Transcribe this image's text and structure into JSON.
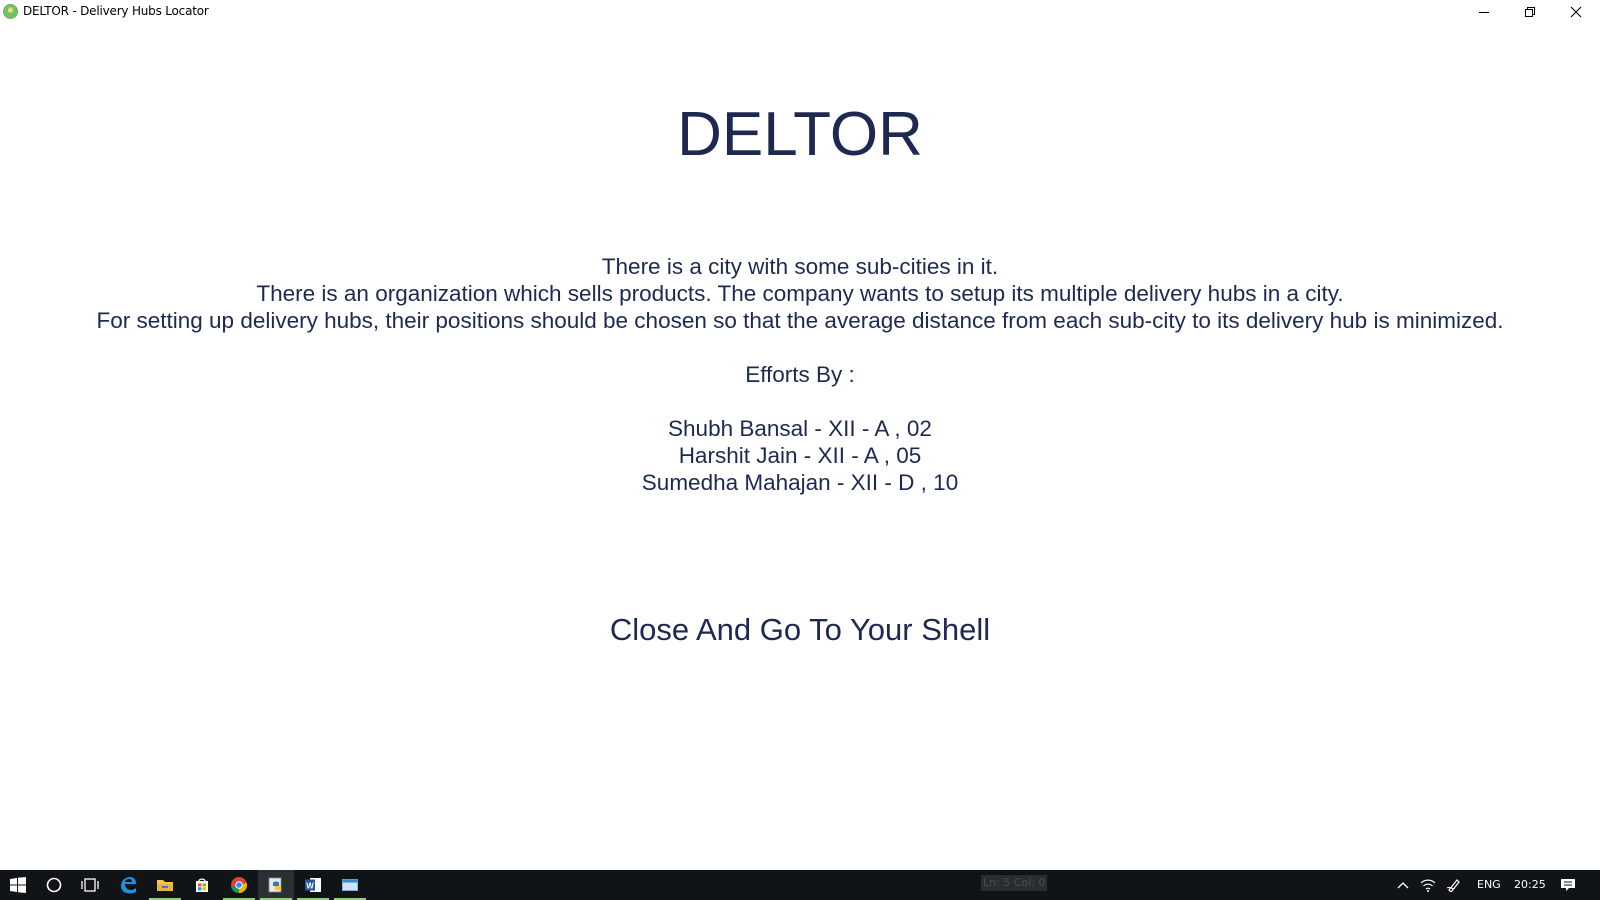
{
  "window": {
    "title": "DELTOR - Delivery Hubs Locator",
    "icon": "app-globe-icon",
    "controls": [
      "minimize-icon",
      "restore-icon",
      "close-icon"
    ]
  },
  "main": {
    "heading": "DELTOR",
    "description_lines": [
      "There is a city with some sub-cities in it.",
      "There is an organization which sells products. The company wants to setup its multiple delivery hubs in a city.",
      "For setting up delivery hubs, their positions should be chosen so that the average distance from each sub-city to its delivery hub is minimized."
    ],
    "efforts_label": "Efforts By :",
    "members": [
      "Shubh Bansal - XII - A , 02",
      "Harshit Jain - XII - A , 05",
      "Sumedha Mahajan - XII - D , 10"
    ],
    "close_button_label": "Close And Go To Your Shell"
  },
  "taskbar": {
    "status_text": "Ln: 5 Col: 0",
    "language": "ENG",
    "time": "20:25",
    "apps": [
      {
        "icon": "windows-start-icon",
        "running": false
      },
      {
        "icon": "search-circle-icon",
        "running": false
      },
      {
        "icon": "task-view-icon",
        "running": false
      },
      {
        "icon": "edge-browser-icon",
        "running": false
      },
      {
        "icon": "file-explorer-icon",
        "running": true
      },
      {
        "icon": "store-icon",
        "running": false
      },
      {
        "icon": "chrome-icon",
        "running": true
      },
      {
        "icon": "python-idle-icon",
        "running": true
      },
      {
        "icon": "word-icon",
        "running": true
      },
      {
        "icon": "app-window-icon",
        "running": true
      }
    ]
  },
  "colors": {
    "text": "#1d2951",
    "taskbar": "#111417",
    "running_indicator": "#8ad17a"
  }
}
